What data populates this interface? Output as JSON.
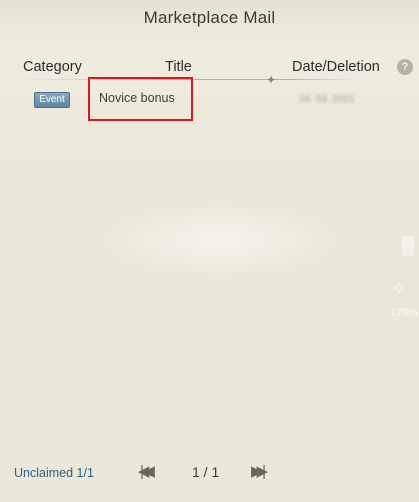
{
  "window": {
    "title": "Marketplace Mail"
  },
  "columns": {
    "category": "Category",
    "title": "Title",
    "date_deletion": "Date/Deletion",
    "help_icon": "?"
  },
  "mail_rows": [
    {
      "category_badge": "Event",
      "title": "Novice bonus",
      "date": "24. 03. 2021"
    }
  ],
  "side_hud": {
    "distance": "179m"
  },
  "footer": {
    "unclaimed": "Unclaimed 1/1",
    "page_indicator": "1 / 1",
    "first_glyph": "|◀◀",
    "next_glyph": "▶▶|"
  },
  "colors": {
    "highlight": "#e0141e",
    "badge": "#6f93ad",
    "unclaimed_text": "#2d5f86"
  }
}
